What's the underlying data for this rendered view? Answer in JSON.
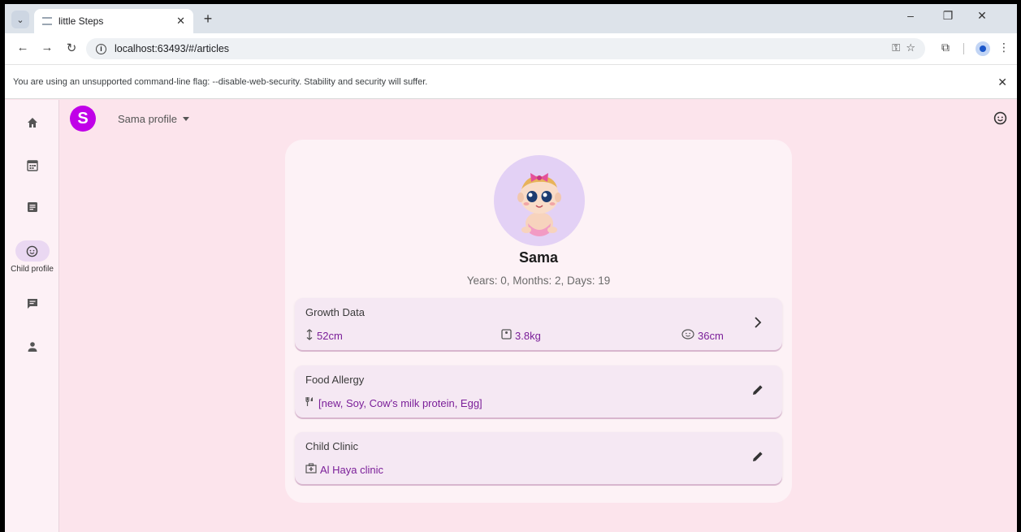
{
  "browser": {
    "tab_title": "little Steps",
    "url": "localhost:63493/#/articles",
    "warning": "You are using an unsupported command-line flag: --disable-web-security. Stability and security will suffer."
  },
  "rail": {
    "items": [
      {
        "icon": "home-icon",
        "label": ""
      },
      {
        "icon": "calendar-icon",
        "label": ""
      },
      {
        "icon": "article-icon",
        "label": ""
      },
      {
        "icon": "baby-face-icon",
        "label": "Child profile"
      },
      {
        "icon": "chat-icon",
        "label": ""
      },
      {
        "icon": "person-icon",
        "label": ""
      }
    ]
  },
  "header": {
    "avatar_letter": "S",
    "profile_selector": "Sama profile"
  },
  "child": {
    "name": "Sama",
    "age": "Years: 0, Months: 2, Days: 19"
  },
  "growth": {
    "title": "Growth Data",
    "height": "52cm",
    "weight": "3.8kg",
    "head": "36cm"
  },
  "allergy": {
    "title": "Food Allergy",
    "value": "[new, Soy, Cow's milk protein, Egg]"
  },
  "clinic": {
    "title": "Child Clinic",
    "value": "Al Haya clinic"
  },
  "colors": {
    "page_bg": "#fce4ec",
    "accent": "#7b1f99",
    "avatar": "#c000e8"
  }
}
